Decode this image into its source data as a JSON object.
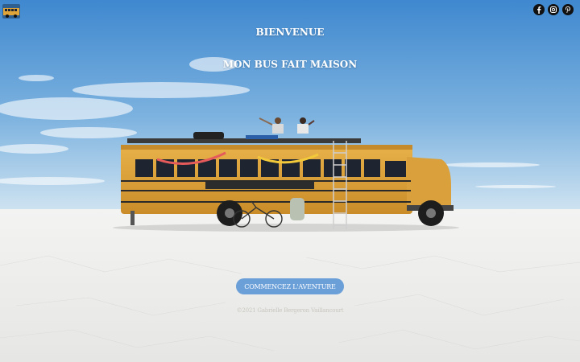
{
  "header": {
    "logo_icon": "bus-logo-icon",
    "social_icons": [
      "facebook-icon",
      "instagram-icon",
      "pinterest-icon"
    ]
  },
  "hero": {
    "title_1": "BIENVENUE",
    "title_2": "MON BUS FAIT MAISON",
    "cta_label": "COMMENCEZ L'AVENTURE",
    "copyright": "©2021 Gabrielle Bergeron Vaillancourt"
  },
  "colors": {
    "sky_top": "#3f88cf",
    "sky_horizon": "#cfe3f1",
    "salt_flat": "#eeeeec",
    "bus_yellow": "#e0a53a",
    "cta_blue": "#6a9fd8"
  }
}
